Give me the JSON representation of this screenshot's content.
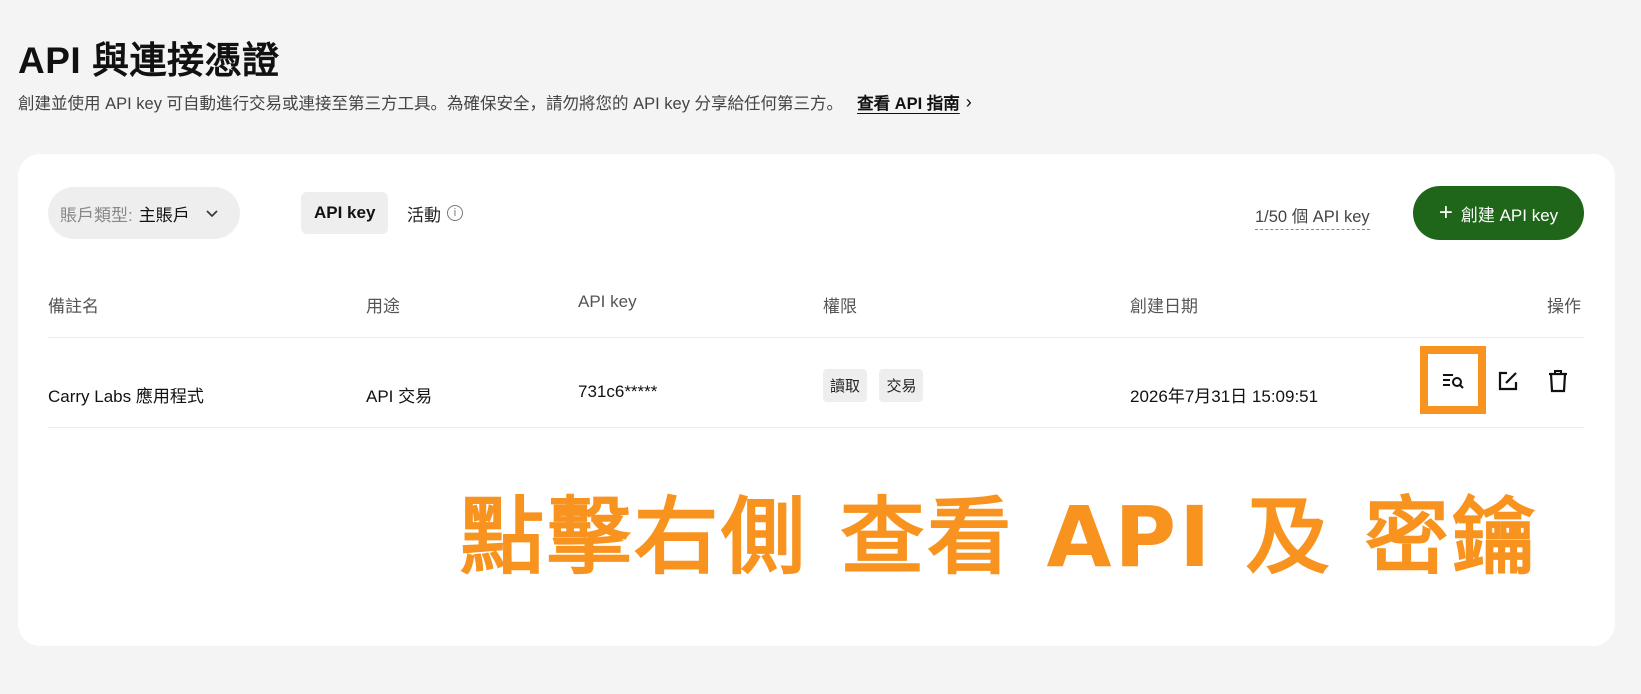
{
  "page": {
    "title": "API 與連接憑證",
    "description": "創建並使用 API key 可自動進行交易或連接至第三方工具。為確保安全，請勿將您的 API key 分享給任何第三方。",
    "guide_link": "查看 API 指南"
  },
  "toolbar": {
    "account_label": "賬戶類型:",
    "account_value": "主賬戶",
    "tabs": [
      {
        "label": "API key",
        "active": true
      },
      {
        "label": "活動",
        "active": false
      }
    ],
    "quota": "1/50 個 API key",
    "create_button": "創建 API key"
  },
  "table": {
    "headers": [
      "備註名",
      "用途",
      "API key",
      "權限",
      "創建日期",
      "操作"
    ],
    "rows": [
      {
        "name": "Carry Labs 應用程式",
        "purpose": "API 交易",
        "api_key": "731c6*****",
        "permissions": [
          "讀取",
          "交易"
        ],
        "created": "2026年7月31日 15:09:51"
      }
    ]
  },
  "annotation": {
    "text": "點擊右側 查看 API 及 密鑰",
    "color": "#f7931e"
  },
  "colors": {
    "brand_green": "#20661a",
    "highlight_orange": "#f7931e"
  }
}
